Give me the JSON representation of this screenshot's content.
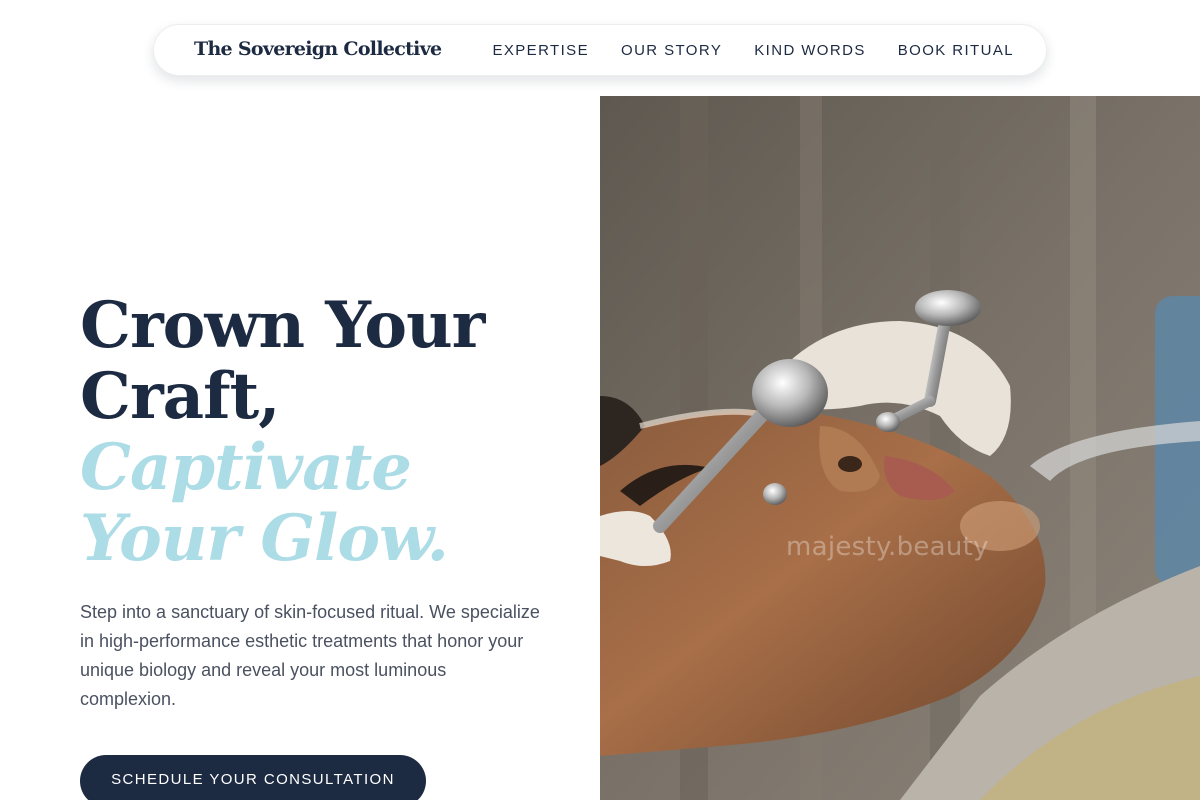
{
  "nav": {
    "brand": "The Sovereign Collective",
    "links": [
      "EXPERTISE",
      "OUR STORY",
      "KIND WORDS",
      "BOOK RITUAL"
    ]
  },
  "hero": {
    "headline_line1": "Crown Your",
    "headline_line2": "Craft,",
    "headline_accent1": "Captivate",
    "headline_accent2": "Your Glow.",
    "intro": "Step into a sanctuary of skin-focused ritual. We specialize in high-performance esthetic treatments that honor your unique biology and reveal your most luminous complexion.",
    "cta_label": "SCHEDULE YOUR CONSULTATION"
  },
  "image": {
    "watermark": "majesty.beauty"
  },
  "colors": {
    "navy": "#1c2a42",
    "accent": "#acdce6",
    "body_text": "#4a5160"
  }
}
